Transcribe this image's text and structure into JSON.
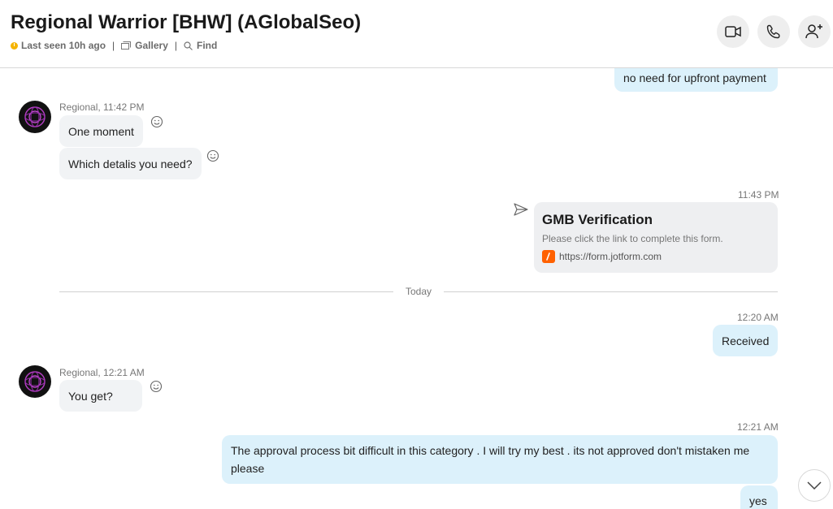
{
  "header": {
    "title": "Regional Warrior [BHW] (AGlobalSeo)",
    "last_seen": "Last seen 10h ago",
    "gallery_label": "Gallery",
    "find_label": "Find",
    "separator": "|"
  },
  "messages": {
    "out_top": "no need for upfront payment",
    "group1_sender": "Regional, 11:42 PM",
    "group1_msg1": "One moment",
    "group1_msg2": "Which detalis you need?",
    "card_time": "11:43 PM",
    "card_title": "GMB Verification",
    "card_desc": "Please click the link to complete this form.",
    "card_link": "https://form.jotform.com",
    "divider": "Today",
    "received_time": "12:20 AM",
    "received_msg": "Received",
    "group2_sender": "Regional, 12:21 AM",
    "group2_msg": "You get?",
    "long_time": "12:21 AM",
    "long_msg": "The approval process bit difficult in this category . I will try my best . its not approved don't mistaken me please",
    "yes_msg": "yes"
  },
  "colors": {
    "incoming_bubble": "#f1f3f5",
    "outgoing_bubble": "#dcf1fb",
    "status_away": "#f5b400",
    "jotform_orange": "#ff6100"
  },
  "icons": {
    "video": "video-call-icon",
    "call": "phone-icon",
    "add_person": "add-person-icon",
    "gallery": "gallery-icon",
    "find": "search-icon",
    "react": "smiley-icon",
    "sent": "send-icon",
    "scroll": "chevron-down-icon"
  }
}
